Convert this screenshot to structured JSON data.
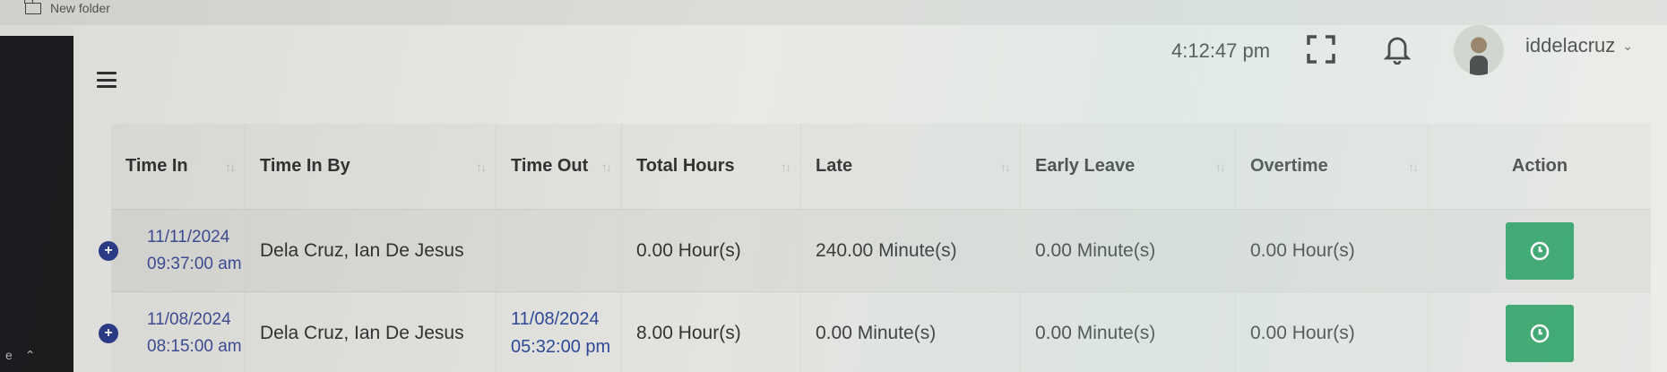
{
  "folder": {
    "label": "New folder"
  },
  "header": {
    "time": "4:12:47 pm",
    "username": "iddelacruz"
  },
  "table": {
    "columns": [
      "Time In",
      "Time In By",
      "Time Out",
      "Total Hours",
      "Late",
      "Early Leave",
      "Overtime",
      "Action"
    ],
    "rows": [
      {
        "time_in_date": "11/11/2024",
        "time_in_time": "09:37:00 am",
        "time_in_by": "Dela Cruz, Ian De Jesus",
        "time_out_date": "",
        "time_out_time": "",
        "total_hours": "0.00 Hour(s)",
        "late": "240.00 Minute(s)",
        "early_leave": "0.00 Minute(s)",
        "overtime": "0.00 Hour(s)"
      },
      {
        "time_in_date": "11/08/2024",
        "time_in_time": "08:15:00 am",
        "time_in_by": "Dela Cruz, Ian De Jesus",
        "time_out_date": "11/08/2024",
        "time_out_time": "05:32:00 pm",
        "total_hours": "8.00 Hour(s)",
        "late": "0.00 Minute(s)",
        "early_leave": "0.00 Minute(s)",
        "overtime": "0.00 Hour(s)"
      }
    ]
  },
  "colors": {
    "action_green": "#1f9a5a",
    "link_blue": "#3f4e97"
  },
  "icons": [
    "folder-icon",
    "menu-icon",
    "fullscreen-icon",
    "bell-icon",
    "avatar",
    "chevron-down-icon",
    "sort-icon",
    "expand-icon",
    "clock-icon"
  ]
}
